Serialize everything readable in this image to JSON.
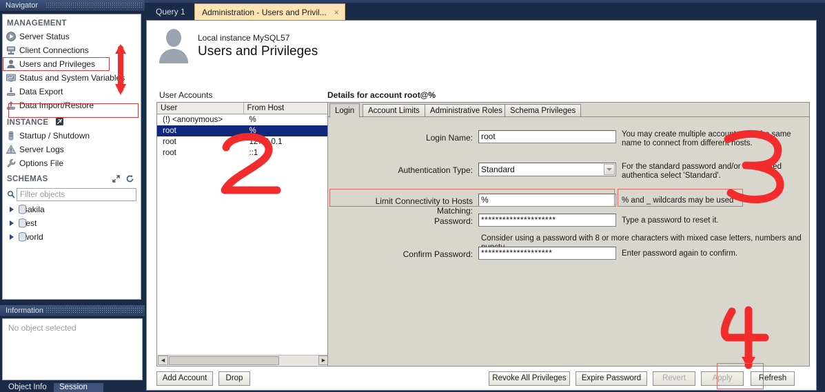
{
  "window": {
    "workspace_tabs": [
      {
        "label": "Query 1",
        "active": false
      },
      {
        "label": "Administration - Users and Privil...",
        "active": true,
        "close": "×"
      }
    ]
  },
  "navigator": {
    "title": "Navigator",
    "sections": [
      {
        "heading": "MANAGEMENT",
        "items": [
          {
            "label": "Server Status",
            "icon": "server-status-icon",
            "highlighted": false
          },
          {
            "label": "Client Connections",
            "icon": "client-connections-icon",
            "highlighted": false
          },
          {
            "label": "Users and Privileges",
            "icon": "users-privileges-icon",
            "highlighted": true
          },
          {
            "label": "Status and System Variables",
            "icon": "status-variables-icon",
            "highlighted": false
          },
          {
            "label": "Data Export",
            "icon": "data-export-icon",
            "highlighted": false
          },
          {
            "label": "Data Import/Restore",
            "icon": "data-import-icon",
            "highlighted": false
          }
        ]
      },
      {
        "heading": "INSTANCE",
        "items": [
          {
            "label": "Startup / Shutdown",
            "icon": "startup-shutdown-icon",
            "highlighted": false
          },
          {
            "label": "Server Logs",
            "icon": "server-logs-icon",
            "highlighted": false
          },
          {
            "label": "Options File",
            "icon": "options-file-icon",
            "highlighted": false
          }
        ]
      }
    ],
    "schemas": {
      "heading": "SCHEMAS",
      "filter_placeholder": "Filter objects",
      "filter_value": "",
      "items": [
        "sakila",
        "test",
        "world"
      ]
    }
  },
  "information": {
    "title": "Information",
    "empty_text": "No object selected",
    "tabs": [
      {
        "label": "Object Info",
        "selected": false
      },
      {
        "label": "Session",
        "selected": true
      }
    ]
  },
  "page": {
    "instance_subtitle": "Local instance MySQL57",
    "title": "Users and Privileges",
    "accounts_label": "User Accounts",
    "details_label": "Details for account root@%"
  },
  "accounts": {
    "columns": [
      "User",
      "From Host"
    ],
    "rows": [
      {
        "user": "(!) <anonymous>",
        "host": "%",
        "selected": false
      },
      {
        "user": "root",
        "host": "%",
        "selected": true
      },
      {
        "user": "root",
        "host": "127.0.0.1",
        "selected": false
      },
      {
        "user": "root",
        "host": "::1",
        "selected": false
      }
    ],
    "buttons": [
      {
        "label": "Add Account",
        "enabled": true
      },
      {
        "label": "Drop",
        "enabled": true
      }
    ]
  },
  "details": {
    "tabs": [
      {
        "label": "Login",
        "active": true
      },
      {
        "label": "Account Limits",
        "active": false
      },
      {
        "label": "Administrative Roles",
        "active": false
      },
      {
        "label": "Schema Privileges",
        "active": false
      }
    ],
    "fields": {
      "login_name_label": "Login Name:",
      "login_name_value": "root",
      "login_name_help": "You may create multiple accounts with the same name to connect from different hosts.",
      "auth_type_label": "Authentication Type:",
      "auth_type_value": "Standard",
      "auth_type_help": "For the standard password and/or host based authentica select 'Standard'.",
      "limit_hosts_label": "Limit Connectivity to Hosts Matching:",
      "limit_hosts_value": "%",
      "limit_hosts_help": "% and _ wildcards may be used",
      "password_label": "Password:",
      "password_value": "*********************",
      "password_help": "Type a password to reset it.",
      "password_hint": "Consider using a password with 8 or more characters with mixed case letters, numbers and punctu",
      "confirm_label": "Confirm Password:",
      "confirm_value": "********************",
      "confirm_help": "Enter password again to confirm."
    },
    "buttons": [
      {
        "label": "Revoke All Privileges",
        "enabled": true
      },
      {
        "label": "Expire Password",
        "enabled": true
      },
      {
        "label": "Revert",
        "enabled": false
      },
      {
        "label": "Apply",
        "enabled": false
      },
      {
        "label": "Refresh",
        "enabled": true
      }
    ]
  },
  "annotations": {
    "color": "#f22c2c",
    "markers": [
      {
        "id": "1",
        "kind": "vertical-arrow"
      },
      {
        "id": "2",
        "kind": "digit",
        "text": "2"
      },
      {
        "id": "3",
        "kind": "digit",
        "text": "3"
      },
      {
        "id": "4",
        "kind": "digit-with-arrow",
        "text": "4"
      }
    ]
  },
  "colors": {
    "accent": "#10277c",
    "annotation_red": "#f22c2c",
    "highlight_box": "#d03a3a",
    "active_tab": "#fce3b4",
    "panel_bg": "#d9d6ce"
  }
}
